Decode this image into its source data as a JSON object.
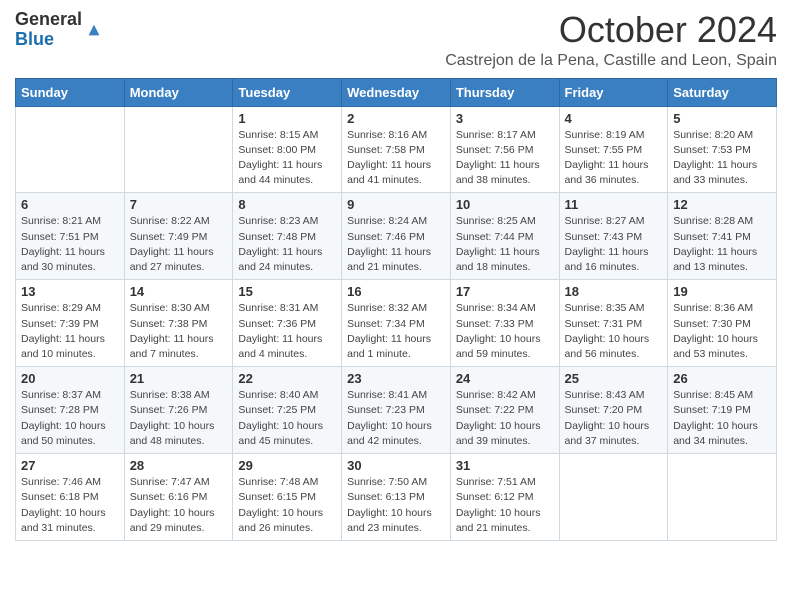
{
  "header": {
    "logo_general": "General",
    "logo_blue": "Blue",
    "month_title": "October 2024",
    "location": "Castrejon de la Pena, Castille and Leon, Spain"
  },
  "days_of_week": [
    "Sunday",
    "Monday",
    "Tuesday",
    "Wednesday",
    "Thursday",
    "Friday",
    "Saturday"
  ],
  "weeks": [
    [
      {
        "day": null,
        "info": null
      },
      {
        "day": null,
        "info": null
      },
      {
        "day": "1",
        "info": "Sunrise: 8:15 AM\nSunset: 8:00 PM\nDaylight: 11 hours and 44 minutes."
      },
      {
        "day": "2",
        "info": "Sunrise: 8:16 AM\nSunset: 7:58 PM\nDaylight: 11 hours and 41 minutes."
      },
      {
        "day": "3",
        "info": "Sunrise: 8:17 AM\nSunset: 7:56 PM\nDaylight: 11 hours and 38 minutes."
      },
      {
        "day": "4",
        "info": "Sunrise: 8:19 AM\nSunset: 7:55 PM\nDaylight: 11 hours and 36 minutes."
      },
      {
        "day": "5",
        "info": "Sunrise: 8:20 AM\nSunset: 7:53 PM\nDaylight: 11 hours and 33 minutes."
      }
    ],
    [
      {
        "day": "6",
        "info": "Sunrise: 8:21 AM\nSunset: 7:51 PM\nDaylight: 11 hours and 30 minutes."
      },
      {
        "day": "7",
        "info": "Sunrise: 8:22 AM\nSunset: 7:49 PM\nDaylight: 11 hours and 27 minutes."
      },
      {
        "day": "8",
        "info": "Sunrise: 8:23 AM\nSunset: 7:48 PM\nDaylight: 11 hours and 24 minutes."
      },
      {
        "day": "9",
        "info": "Sunrise: 8:24 AM\nSunset: 7:46 PM\nDaylight: 11 hours and 21 minutes."
      },
      {
        "day": "10",
        "info": "Sunrise: 8:25 AM\nSunset: 7:44 PM\nDaylight: 11 hours and 18 minutes."
      },
      {
        "day": "11",
        "info": "Sunrise: 8:27 AM\nSunset: 7:43 PM\nDaylight: 11 hours and 16 minutes."
      },
      {
        "day": "12",
        "info": "Sunrise: 8:28 AM\nSunset: 7:41 PM\nDaylight: 11 hours and 13 minutes."
      }
    ],
    [
      {
        "day": "13",
        "info": "Sunrise: 8:29 AM\nSunset: 7:39 PM\nDaylight: 11 hours and 10 minutes."
      },
      {
        "day": "14",
        "info": "Sunrise: 8:30 AM\nSunset: 7:38 PM\nDaylight: 11 hours and 7 minutes."
      },
      {
        "day": "15",
        "info": "Sunrise: 8:31 AM\nSunset: 7:36 PM\nDaylight: 11 hours and 4 minutes."
      },
      {
        "day": "16",
        "info": "Sunrise: 8:32 AM\nSunset: 7:34 PM\nDaylight: 11 hours and 1 minute."
      },
      {
        "day": "17",
        "info": "Sunrise: 8:34 AM\nSunset: 7:33 PM\nDaylight: 10 hours and 59 minutes."
      },
      {
        "day": "18",
        "info": "Sunrise: 8:35 AM\nSunset: 7:31 PM\nDaylight: 10 hours and 56 minutes."
      },
      {
        "day": "19",
        "info": "Sunrise: 8:36 AM\nSunset: 7:30 PM\nDaylight: 10 hours and 53 minutes."
      }
    ],
    [
      {
        "day": "20",
        "info": "Sunrise: 8:37 AM\nSunset: 7:28 PM\nDaylight: 10 hours and 50 minutes."
      },
      {
        "day": "21",
        "info": "Sunrise: 8:38 AM\nSunset: 7:26 PM\nDaylight: 10 hours and 48 minutes."
      },
      {
        "day": "22",
        "info": "Sunrise: 8:40 AM\nSunset: 7:25 PM\nDaylight: 10 hours and 45 minutes."
      },
      {
        "day": "23",
        "info": "Sunrise: 8:41 AM\nSunset: 7:23 PM\nDaylight: 10 hours and 42 minutes."
      },
      {
        "day": "24",
        "info": "Sunrise: 8:42 AM\nSunset: 7:22 PM\nDaylight: 10 hours and 39 minutes."
      },
      {
        "day": "25",
        "info": "Sunrise: 8:43 AM\nSunset: 7:20 PM\nDaylight: 10 hours and 37 minutes."
      },
      {
        "day": "26",
        "info": "Sunrise: 8:45 AM\nSunset: 7:19 PM\nDaylight: 10 hours and 34 minutes."
      }
    ],
    [
      {
        "day": "27",
        "info": "Sunrise: 7:46 AM\nSunset: 6:18 PM\nDaylight: 10 hours and 31 minutes."
      },
      {
        "day": "28",
        "info": "Sunrise: 7:47 AM\nSunset: 6:16 PM\nDaylight: 10 hours and 29 minutes."
      },
      {
        "day": "29",
        "info": "Sunrise: 7:48 AM\nSunset: 6:15 PM\nDaylight: 10 hours and 26 minutes."
      },
      {
        "day": "30",
        "info": "Sunrise: 7:50 AM\nSunset: 6:13 PM\nDaylight: 10 hours and 23 minutes."
      },
      {
        "day": "31",
        "info": "Sunrise: 7:51 AM\nSunset: 6:12 PM\nDaylight: 10 hours and 21 minutes."
      },
      {
        "day": null,
        "info": null
      },
      {
        "day": null,
        "info": null
      }
    ]
  ]
}
